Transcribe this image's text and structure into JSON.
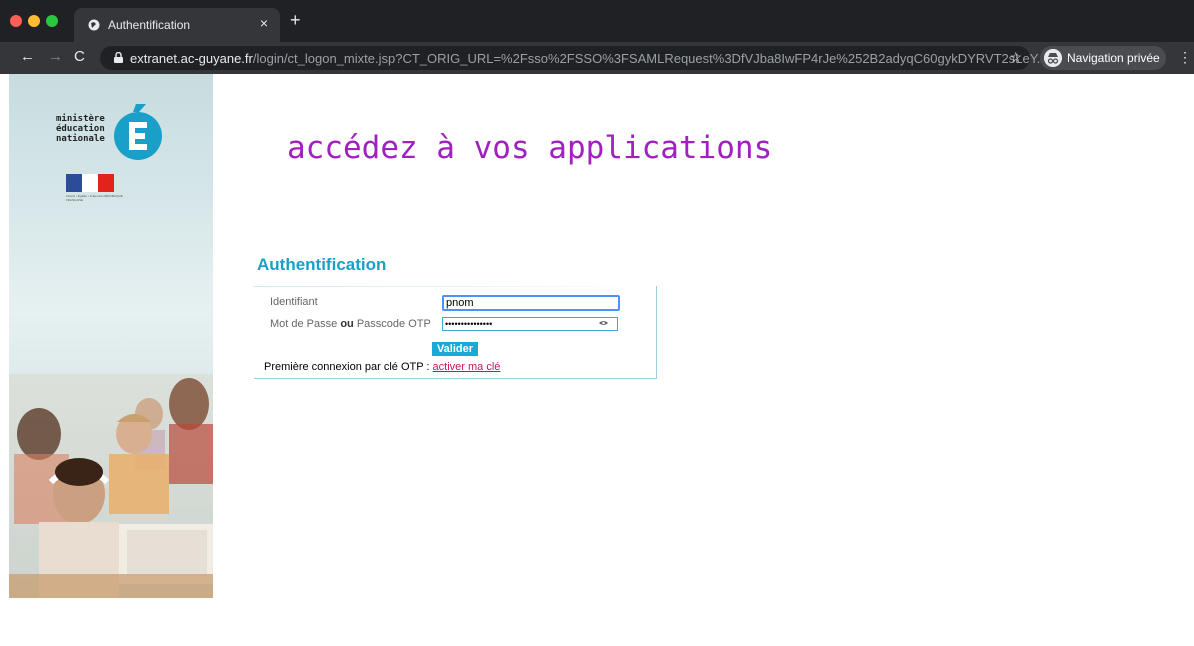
{
  "browser": {
    "tab_title": "Authentification",
    "tab_close": "×",
    "new_tab": "+",
    "url_host": "extranet.ac-guyane.fr",
    "url_path": "/login/ct_logon_mixte.jsp?CT_ORIG_URL=%2Fsso%2FSSO%3FSAMLRequest%3DfVJba8IwFP4rJe%252B2adyqC60gykDYRVT2sLeY...",
    "incognito_label": "Navigation privée",
    "menu": "⋮",
    "back": "←",
    "forward": "→",
    "reload": "C",
    "star": "☆"
  },
  "logo": {
    "text_line1": "ministère",
    "text_line2": "éducation",
    "text_line3": "nationale",
    "flag_colors": [
      "#2d4b9b",
      "#ffffff",
      "#e2231a"
    ],
    "flag_caption": "Liberté • Égalité • Fraternité RÉPUBLIQUE FRANÇAISE"
  },
  "page": {
    "headline": "accédez à vos applications",
    "auth_title": "Authentification"
  },
  "form": {
    "id_label": "Identifiant",
    "pw_label_pre": "Mot de Passe ",
    "pw_label_bold": "ou",
    "pw_label_post": " Passcode OTP",
    "id_value": "pnom",
    "pw_value": "•••••••••••••••",
    "submit": "Valider",
    "otp_text": "Première connexion par clé OTP : ",
    "otp_link": "activer ma clé"
  },
  "colors": {
    "accent": "#1a9fc8",
    "headline": "#a020c0",
    "link": "#c2185b"
  }
}
